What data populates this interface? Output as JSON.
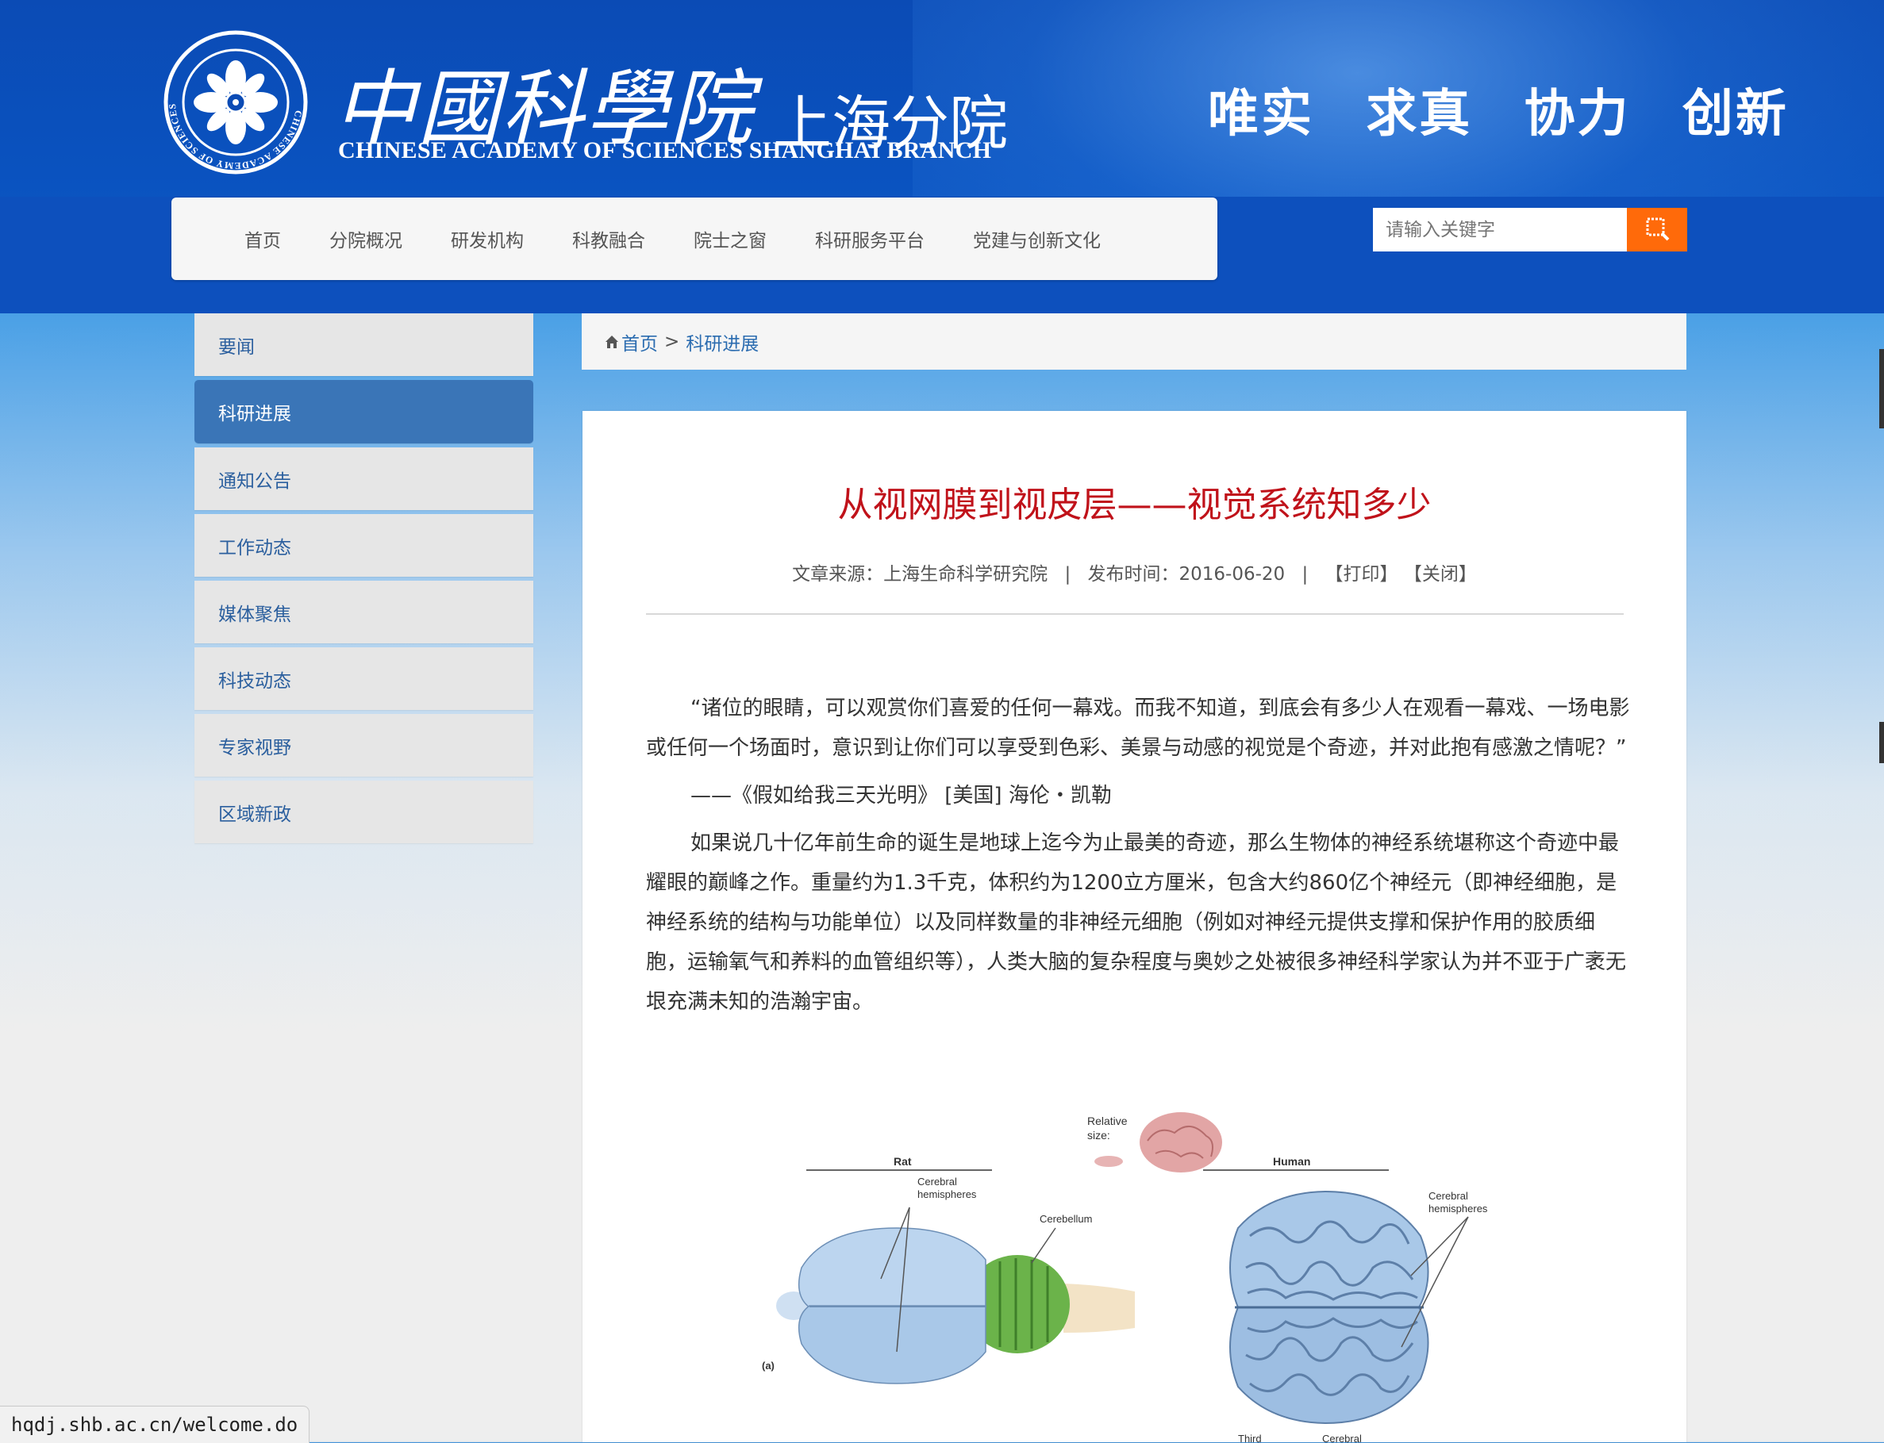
{
  "header": {
    "logo_cn_main": "中國科學院",
    "logo_cn_sub": "上海分院",
    "logo_en": "CHINESE ACADEMY OF SCIENCES SHANGHAI BRANCH",
    "motto": "唯实 求真 协力 创新",
    "emblem_ring_text": "CHINESE ACADEMY OF SCIENCES"
  },
  "nav": {
    "items": [
      "首页",
      "分院概况",
      "研发机构",
      "科教融合",
      "院士之窗",
      "科研服务平台",
      "党建与创新文化"
    ]
  },
  "search": {
    "placeholder": "请输入关键字",
    "button_icon": "search-icon"
  },
  "sidebar": {
    "items": [
      {
        "label": "要闻",
        "active": false
      },
      {
        "label": "科研进展",
        "active": true
      },
      {
        "label": "通知公告",
        "active": false
      },
      {
        "label": "工作动态",
        "active": false
      },
      {
        "label": "媒体聚焦",
        "active": false
      },
      {
        "label": "科技动态",
        "active": false
      },
      {
        "label": "专家视野",
        "active": false
      },
      {
        "label": "区域新政",
        "active": false
      }
    ]
  },
  "breadcrumb": {
    "home_icon": "home-icon",
    "home": "首页",
    "separator": ">",
    "current": "科研进展"
  },
  "article": {
    "title": "从视网膜到视皮层——视觉系统知多少",
    "source_label": "文章来源：上海生命科学研究院",
    "date_label": "发布时间：2016-06-20",
    "separator": "|",
    "print": "【打印】",
    "close": "【关闭】",
    "paragraphs": [
      "“诸位的眼睛，可以观赏你们喜爱的任何一幕戏。而我不知道，到底会有多少人在观看一幕戏、一场电影或任何一个场面时，意识到让你们可以享受到色彩、美景与动感的视觉是个奇迹，并对此抱有感激之情呢？”",
      "——《假如给我三天光明》 [美国] 海伦・凯勒",
      "如果说几十亿年前生命的诞生是地球上迄今为止最美的奇迹，那么生物体的神经系统堪称这个奇迹中最耀眼的巅峰之作。重量约为1.3千克，体积约为1200立方厘米，包含大约860亿个神经元（即神经细胞，是神经系统的结构与功能单位）以及同样数量的非神经元细胞（例如对神经元提供支撑和保护作用的胶质细胞，运输氧气和养料的血管组织等），人类大脑的复杂程度与奥妙之处被很多神经科学家认为并不亚于广袤无垠充满未知的浩瀚宇宙。"
    ],
    "figure": {
      "relative_size": "Relative",
      "relative_size_2": "size:",
      "rat_title": "Rat",
      "human_title": "Human",
      "rat_cerebral": "Cerebral",
      "rat_hemispheres": "hemispheres",
      "cerebellum": "Cerebellum",
      "human_cerebral": "Cerebral",
      "human_hemispheres": "hemispheres",
      "panel": "(a)",
      "third": "Third",
      "cerebral_bottom": "Cerebral"
    }
  },
  "status_bar": {
    "url": "hqdj.shb.ac.cn/welcome.do"
  },
  "colors": {
    "header_blue": "#0b4bb5",
    "nav_bg": "#f6f6f6",
    "search_button": "#ff6a0a",
    "sidebar_active": "#3a75b7",
    "link": "#2b6cb0",
    "title_red": "#c0121a"
  }
}
